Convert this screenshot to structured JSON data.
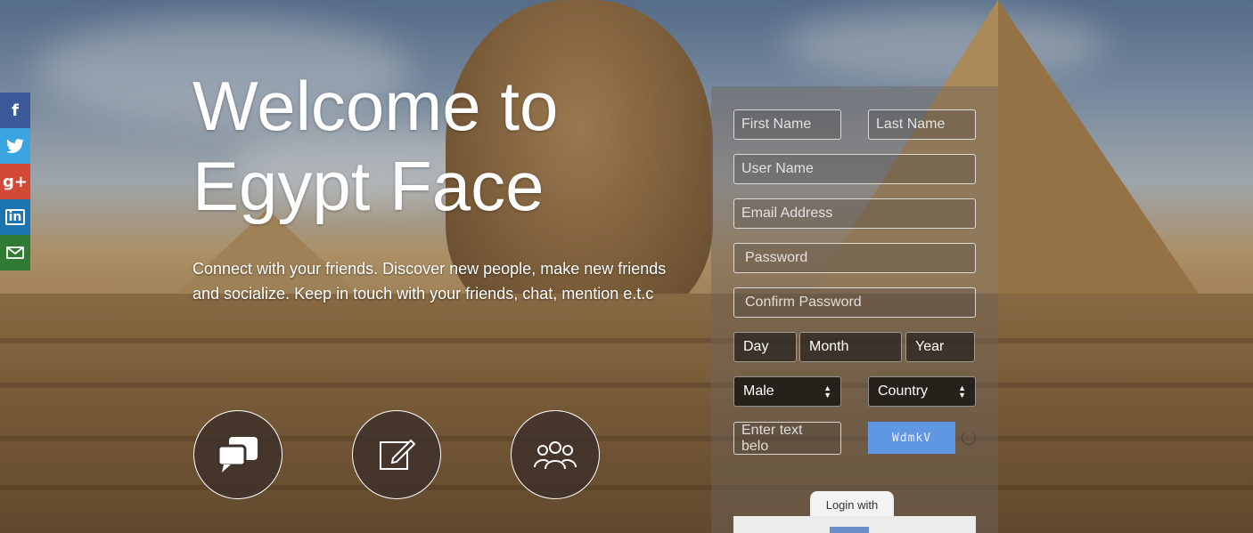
{
  "social": {
    "facebook_icon": "f",
    "google_icon": "g+",
    "linkedin_icon": "in"
  },
  "hero": {
    "title": "Welcome to Egypt Face",
    "text": "Connect with your friends. Discover new people, make new friends and socialize. Keep in touch with your friends, chat, mention e.t.c"
  },
  "features": [
    {
      "icon": "chat-bubbles-icon"
    },
    {
      "icon": "edit-icon"
    },
    {
      "icon": "group-icon"
    }
  ],
  "signup": {
    "first_name": "First Name",
    "last_name": "Last Name",
    "user_name": "User Name",
    "email": "Email Address",
    "password": "Password",
    "confirm_password": "Confirm Password",
    "day": "Day",
    "month": "Month",
    "year": "Year",
    "gender": "Male",
    "country": "Country",
    "captcha_placeholder": "Enter text belo",
    "captcha_text": "WdmkV"
  },
  "login": {
    "label": "Login with"
  }
}
